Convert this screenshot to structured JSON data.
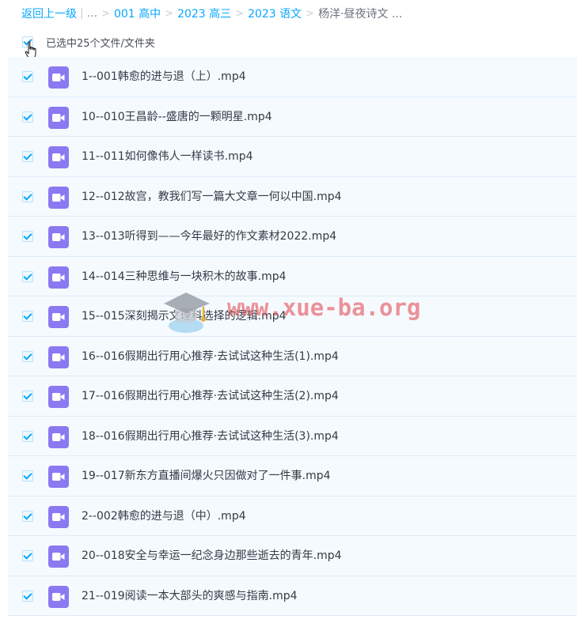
{
  "breadcrumb": {
    "back": "返回上一级",
    "ellipsis": "...",
    "items": [
      "001 高中",
      "2023 高三",
      "2023 语文"
    ],
    "current": "杨洋·昼夜诗文 ..."
  },
  "selection": {
    "label": "已选中25个文件/文件夹",
    "checked": true
  },
  "files": [
    {
      "name": "1--001韩愈的进与退（上）.mp4",
      "checked": true,
      "icon": "video-icon"
    },
    {
      "name": "10--010王昌龄--盛唐的一颗明星.mp4",
      "checked": true,
      "icon": "video-icon"
    },
    {
      "name": "11--011如何像伟人一样读书.mp4",
      "checked": true,
      "icon": "video-icon"
    },
    {
      "name": "12--012故宫，教我们写一篇大文章一何以中国.mp4",
      "checked": true,
      "icon": "video-icon"
    },
    {
      "name": "13--013听得到——今年最好的作文素材2022.mp4",
      "checked": true,
      "icon": "video-icon"
    },
    {
      "name": "14--014三种思维与一块积木的故事.mp4",
      "checked": true,
      "icon": "video-icon"
    },
    {
      "name": "15--015深刻揭示文理科选择的逻辑.mp4",
      "checked": true,
      "icon": "video-icon"
    },
    {
      "name": "16--016假期出行用心推荐·去试试这种生活(1).mp4",
      "checked": true,
      "icon": "video-icon"
    },
    {
      "name": "17--016假期出行用心推荐·去试试这种生活(2).mp4",
      "checked": true,
      "icon": "video-icon"
    },
    {
      "name": "18--016假期出行用心推荐·去试试这种生活(3).mp4",
      "checked": true,
      "icon": "video-icon"
    },
    {
      "name": "19--017新东方直播间爆火只因做对了一件事.mp4",
      "checked": true,
      "icon": "video-icon"
    },
    {
      "name": "2--002韩愈的进与退（中）.mp4",
      "checked": true,
      "icon": "video-icon"
    },
    {
      "name": "20--018安全与幸运一纪念身边那些逝去的青年.mp4",
      "checked": true,
      "icon": "video-icon"
    },
    {
      "name": "21--019阅读一本大部头的爽感与指南.mp4",
      "checked": true,
      "icon": "video-icon"
    }
  ],
  "watermark": {
    "text": "www.xue-ba.org"
  },
  "colors": {
    "link": "#06a7ff",
    "row_bg": "#f5fafe",
    "row_border": "#dcecfa",
    "video_icon": "#8a79f1"
  }
}
